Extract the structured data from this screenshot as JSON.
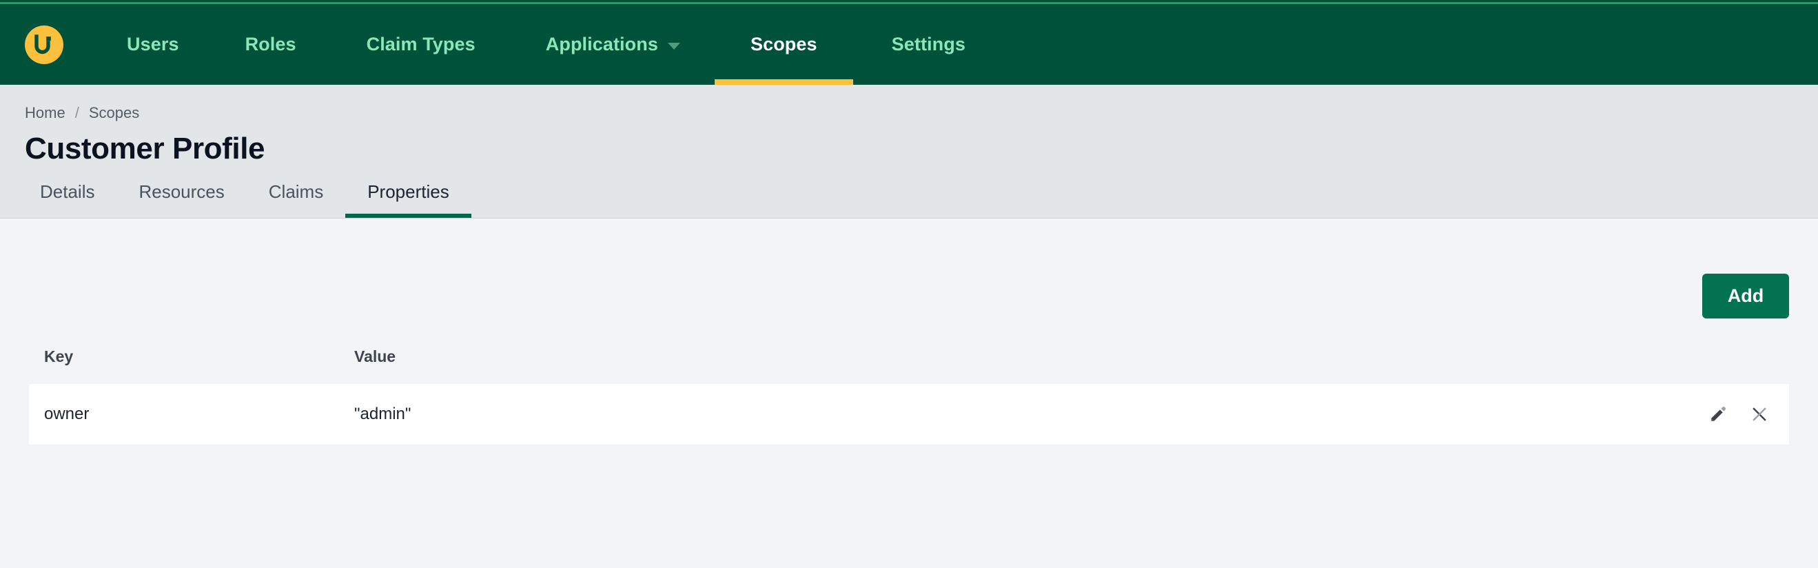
{
  "colors": {
    "nav_bg": "#005139",
    "nav_accent_line": "#1e9e6a",
    "nav_link": "#8ae8b8",
    "nav_active_underline": "#fbc03c",
    "logo_bg": "#fbc03c",
    "page_band_bg": "#e3e6e8",
    "content_bg": "#f2f4f6",
    "tab_active_underline": "#00684a",
    "add_button_bg": "#03734f",
    "title_text": "#0b1220"
  },
  "navbar": {
    "logo_icon": "brand-u-logo-icon",
    "items": [
      {
        "label": "Users",
        "active": false,
        "has_caret": false
      },
      {
        "label": "Roles",
        "active": false,
        "has_caret": false
      },
      {
        "label": "Claim Types",
        "active": false,
        "has_caret": false
      },
      {
        "label": "Applications",
        "active": false,
        "has_caret": true
      },
      {
        "label": "Scopes",
        "active": true,
        "has_caret": false
      },
      {
        "label": "Settings",
        "active": false,
        "has_caret": false
      }
    ]
  },
  "breadcrumb": {
    "items": [
      {
        "label": "Home"
      },
      {
        "label": "Scopes"
      }
    ],
    "separator": "/"
  },
  "page": {
    "title": "Customer Profile"
  },
  "tabs": [
    {
      "label": "Details",
      "active": false
    },
    {
      "label": "Resources",
      "active": false
    },
    {
      "label": "Claims",
      "active": false
    },
    {
      "label": "Properties",
      "active": true
    }
  ],
  "toolbar": {
    "add_label": "Add"
  },
  "table": {
    "headers": {
      "key": "Key",
      "value": "Value",
      "actions": ""
    },
    "rows": [
      {
        "key": "owner",
        "value": "\"admin\"",
        "edit_icon": "pencil-icon",
        "delete_icon": "close-x-icon"
      }
    ]
  }
}
